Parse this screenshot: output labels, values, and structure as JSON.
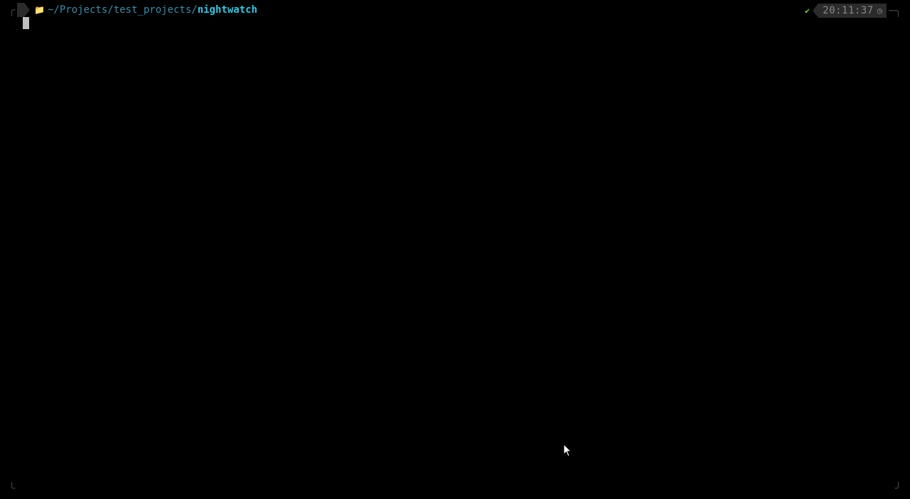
{
  "prompt": {
    "apple_glyph": "",
    "folder_glyph": "",
    "path_prefix": "~/Projects/test_projects/",
    "path_current": "nightwatch"
  },
  "status": {
    "check_glyph": "✔",
    "time": "20:11:37",
    "clock_glyph": "◷"
  },
  "frame": {
    "tl": "╭",
    "bl": "╰",
    "br": "╯"
  }
}
